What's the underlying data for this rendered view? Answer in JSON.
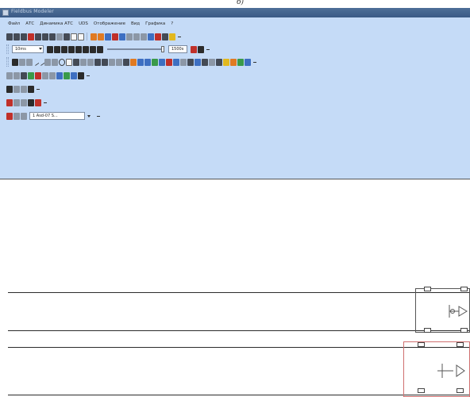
{
  "top_caption": "б)",
  "window": {
    "title": "Fieldbus  Modeler"
  },
  "menu": [
    {
      "label": "Файл"
    },
    {
      "label": "АТС"
    },
    {
      "label": "Динамика АТС"
    },
    {
      "label": "UDS"
    },
    {
      "label": "Отображение"
    },
    {
      "label": "Вид"
    },
    {
      "label": "Графика"
    },
    {
      "label": "?"
    }
  ],
  "toolbar_playback": {
    "speed_value": "10ms",
    "time_value": "1500s"
  },
  "toolbar_text": {
    "combo_value": "1 Asd-07 S..."
  },
  "icons": {
    "standard": [
      "new",
      "open",
      "save",
      "print",
      "cut",
      "copy",
      "paste",
      "preview",
      "print-setup",
      "undo",
      "redo",
      "zoom-in",
      "zoom-out",
      "grid",
      "snap",
      "align",
      "distribute",
      "group",
      "properties",
      "pencil",
      "help"
    ],
    "playback": [
      "rewind",
      "step-back",
      "play-back",
      "stop",
      "play",
      "step-forward",
      "fast-forward",
      "pause",
      "record",
      "stop-red"
    ],
    "draw": [
      "pointer",
      "hand",
      "pin",
      "line",
      "polyline",
      "arc",
      "curve",
      "ellipse",
      "rectangle",
      "text",
      "bus",
      "node",
      "connector",
      "block-a",
      "block-b",
      "table-a",
      "table-b",
      "chart",
      "image",
      "button",
      "lamp",
      "switch",
      "valve",
      "meter",
      "indicator",
      "gauge",
      "font-A",
      "label",
      "frame",
      "shape-yellow",
      "shape-green",
      "shape-blue"
    ],
    "align": [
      "align-left",
      "align-center",
      "align-right",
      "align-top",
      "align-middle",
      "align-bottom",
      "same-width",
      "same-height",
      "same-size",
      "bring-front",
      "send-back"
    ],
    "short1": [
      "select",
      "rotate",
      "pen",
      "fill"
    ],
    "short2": [
      "select",
      "rotate",
      "pen",
      "fill",
      "paint"
    ],
    "short3": [
      "select",
      "rotate",
      "text"
    ]
  }
}
